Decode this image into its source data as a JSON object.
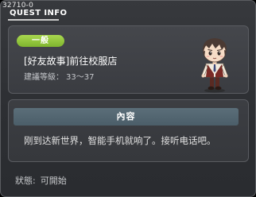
{
  "window": {
    "quest_id": "32710-0",
    "title": "QUEST INFO"
  },
  "quest": {
    "category_badge": "一般",
    "name": "[好友故事]前往校服店",
    "level_label": "建議等級：",
    "level_range": "33～37"
  },
  "content": {
    "header": "內容",
    "text": "刚到达新世界，智能手机就响了。接听电话吧。"
  },
  "status": {
    "label": "狀態:",
    "value": "可開始"
  },
  "colors": {
    "badge": "#8cc63f",
    "content_header": "#556874",
    "panel": "#404247"
  },
  "npc": {
    "icon": "npc-boy-student-sprite"
  }
}
